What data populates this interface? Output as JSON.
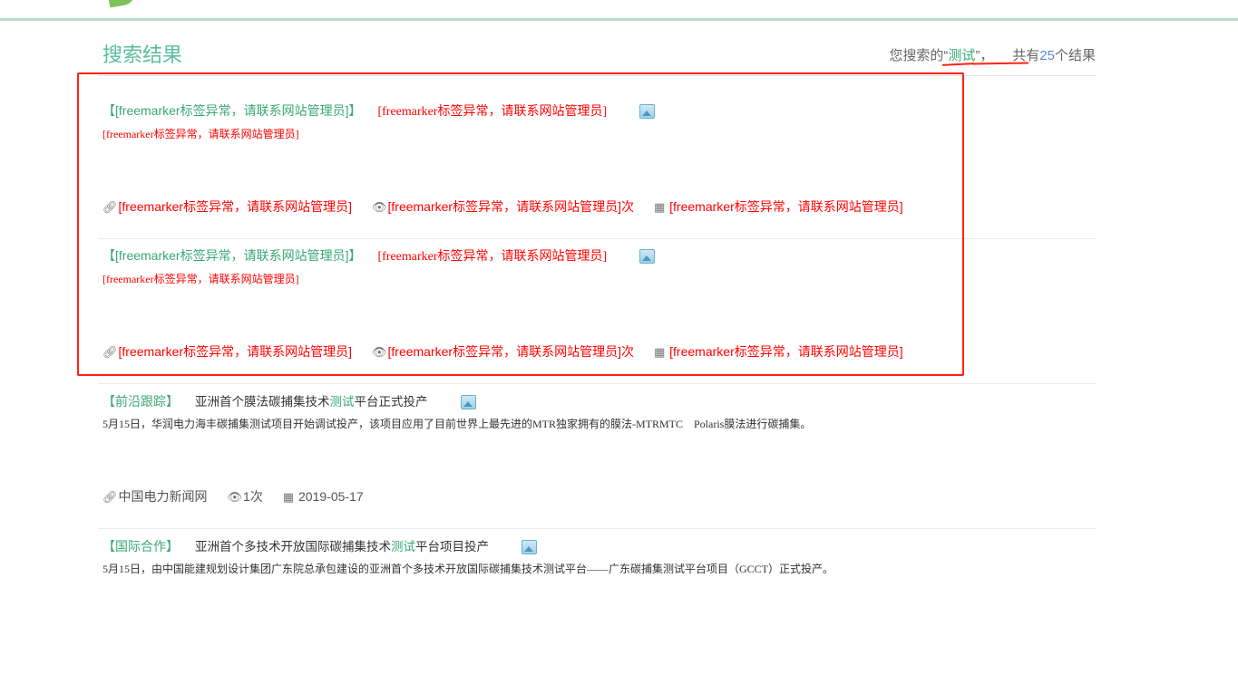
{
  "header": {
    "title": "搜索结果",
    "summary_prefix": "您搜索的“",
    "keyword": "测试",
    "summary_mid": "”，",
    "summary_count_prefix": "共有",
    "count": "25",
    "summary_suffix": "个结果"
  },
  "results": [
    {
      "category": "【[freemarker标签异常，请联系网站管理员]】",
      "title": "[freemarker标签异常，请联系网站管理员]",
      "desc": "[freemarker标签异常，请联系网站管理员]",
      "source": "[freemarker标签异常，请联系网站管理员]",
      "views": "[freemarker标签异常，请联系网站管理员]次",
      "date": "[freemarker标签异常，请联系网站管理员]"
    },
    {
      "category": "【[freemarker标签异常，请联系网站管理员]】",
      "title": "[freemarker标签异常，请联系网站管理员]",
      "desc": "[freemarker标签异常，请联系网站管理员]",
      "source": "[freemarker标签异常，请联系网站管理员]",
      "views": "[freemarker标签异常，请联系网站管理员]次",
      "date": "[freemarker标签异常，请联系网站管理员]"
    },
    {
      "category": "【前沿跟踪】",
      "title_pre": "亚洲首个膜法碳捕集技术",
      "title_hl": "测试",
      "title_post": "平台正式投产",
      "desc": "5月15日，华润电力海丰碳捕集测试项目开始调试投产，该项目应用了目前世界上最先进的MTR独家拥有的膜法-MTRMTC　Polaris膜法进行碳捕集。",
      "source": "中国电力新闻网",
      "views": "1次",
      "date": "2019-05-17"
    },
    {
      "category": "【国际合作】",
      "title_pre": "亚洲首个多技术开放国际碳捕集技术",
      "title_hl": "测试",
      "title_post": "平台项目投产",
      "desc": "5月15日，由中国能建规划设计集团广东院总承包建设的亚洲首个多技术开放国际碳捕集技术测试平台——广东碳捕集测试平台项目（GCCT）正式投产。"
    }
  ]
}
